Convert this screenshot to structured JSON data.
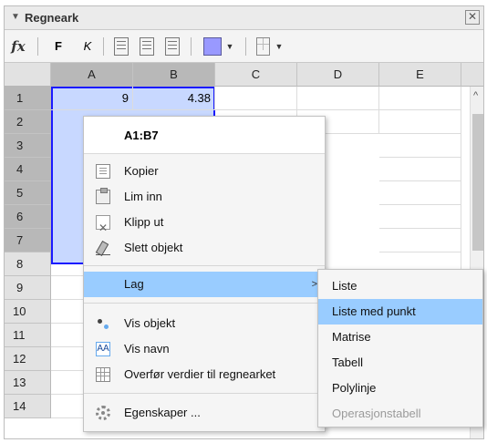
{
  "window": {
    "title": "Regneark",
    "close_icon": "close-icon"
  },
  "toolbar": {
    "fx_label": "fx",
    "bold_label": "F",
    "italic_label": "K",
    "fill_color": "#9999ff"
  },
  "sheet": {
    "columns": [
      "A",
      "B",
      "C",
      "D",
      "E"
    ],
    "rows": [
      "1",
      "2",
      "3",
      "4",
      "5",
      "6",
      "7",
      "8",
      "9",
      "10",
      "11",
      "12",
      "13",
      "14"
    ],
    "cells": {
      "A1": "9",
      "B1": "4.38"
    },
    "selection": "A1:B7",
    "selection_color": "#c8d8ff"
  },
  "context_menu": {
    "header": "A1:B7",
    "items": [
      {
        "label": "Kopier",
        "icon": "copy-icon"
      },
      {
        "label": "Lim inn",
        "icon": "paste-icon"
      },
      {
        "label": "Klipp ut",
        "icon": "cut-icon"
      },
      {
        "label": "Slett objekt",
        "icon": "eraser-icon"
      },
      {
        "label": "Lag",
        "submenu": true
      },
      {
        "label": "Vis objekt",
        "icon": "show-object-icon"
      },
      {
        "label": "Vis navn",
        "icon": "show-name-icon"
      },
      {
        "label": "Overfør verdier til regnearket",
        "icon": "table-icon"
      },
      {
        "label": "Egenskaper ...",
        "icon": "gear-icon"
      }
    ],
    "highlight_color": "#99ccff"
  },
  "submenu": {
    "items": [
      {
        "label": "Liste"
      },
      {
        "label": "Liste med punkt"
      },
      {
        "label": "Matrise"
      },
      {
        "label": "Tabell"
      },
      {
        "label": "Polylinje"
      },
      {
        "label": "Operasjonstabell",
        "disabled": true
      }
    ]
  }
}
